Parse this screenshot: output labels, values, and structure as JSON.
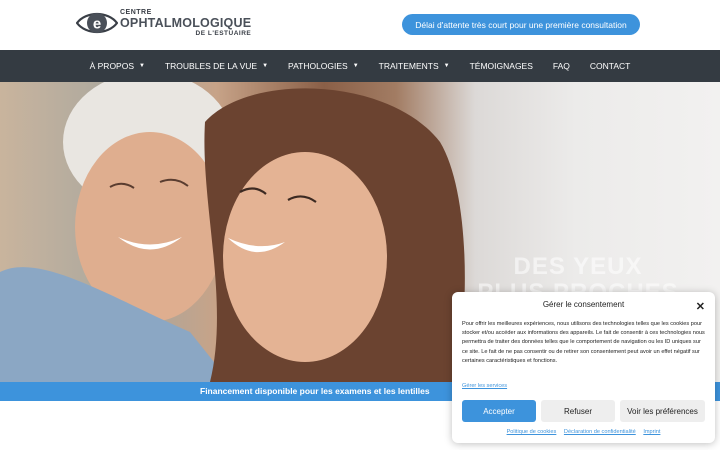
{
  "header": {
    "logo": {
      "line1": "CENTRE",
      "line2": "OPHTALMOLOGIQUE",
      "line3": "DE L'ESTUAIRE",
      "mark": "e"
    },
    "cta": "Délai d'attente très court pour une première consultation"
  },
  "nav": {
    "items": [
      {
        "label": "À PROPOS",
        "dropdown": true
      },
      {
        "label": "TROUBLES DE LA VUE",
        "dropdown": true
      },
      {
        "label": "PATHOLOGIES",
        "dropdown": true
      },
      {
        "label": "TRAITEMENTS",
        "dropdown": true
      },
      {
        "label": "TÉMOIGNAGES",
        "dropdown": false
      },
      {
        "label": "FAQ",
        "dropdown": false
      },
      {
        "label": "CONTACT",
        "dropdown": false
      }
    ],
    "caret": "▼"
  },
  "hero": {
    "title_line1": "DES YEUX",
    "title_line2": "PLUS PROCHES"
  },
  "finance": {
    "text": "Financement disponible pour les examens et les lentilles"
  },
  "consent": {
    "title": "Gérer le consentement",
    "close": "✕",
    "body": "Pour offrir les meilleures expériences, nous utilisons des technologies telles que les cookies pour stocker et/ou accéder aux informations des appareils. Le fait de consentir à ces technologies nous permettra de traiter des données telles que le comportement de navigation ou les ID uniques sur ce site. Le fait de ne pas consentir ou de retirer son consentement peut avoir un effet négatif sur certaines caractéristiques et fonctions.",
    "manage_services": "Gérer les services",
    "accept": "Accepter",
    "refuse": "Refuser",
    "preferences": "Voir les préférences",
    "links": [
      "Politique de cookies",
      "Déclaration de confidentialité",
      "Imprint"
    ]
  },
  "colors": {
    "accent": "#3d93dc",
    "nav_bg": "#343b42",
    "text_dark": "#222222"
  }
}
